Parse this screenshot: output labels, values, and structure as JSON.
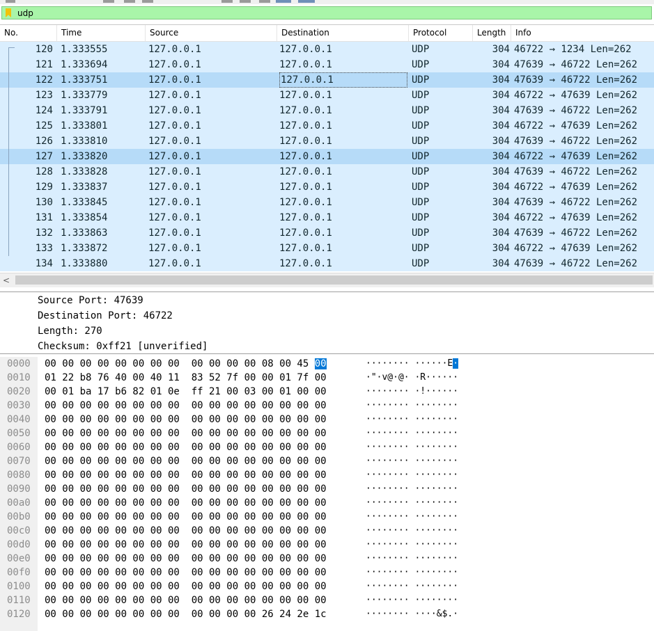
{
  "filter": {
    "value": "udp"
  },
  "columns": [
    "No.",
    "Time",
    "Source",
    "Destination",
    "Protocol",
    "Length",
    "Info"
  ],
  "packets": [
    {
      "no": "120",
      "time": "1.333555",
      "src": "127.0.0.1",
      "dst": "127.0.0.1",
      "proto": "UDP",
      "len": "304",
      "info": "46722 → 1234 Len=262",
      "state": "normal"
    },
    {
      "no": "121",
      "time": "1.333694",
      "src": "127.0.0.1",
      "dst": "127.0.0.1",
      "proto": "UDP",
      "len": "304",
      "info": "47639 → 46722 Len=262",
      "state": "normal"
    },
    {
      "no": "122",
      "time": "1.333751",
      "src": "127.0.0.1",
      "dst": "127.0.0.1",
      "proto": "UDP",
      "len": "304",
      "info": "47639 → 46722 Len=262",
      "state": "selected"
    },
    {
      "no": "123",
      "time": "1.333779",
      "src": "127.0.0.1",
      "dst": "127.0.0.1",
      "proto": "UDP",
      "len": "304",
      "info": "46722 → 47639 Len=262",
      "state": "normal"
    },
    {
      "no": "124",
      "time": "1.333791",
      "src": "127.0.0.1",
      "dst": "127.0.0.1",
      "proto": "UDP",
      "len": "304",
      "info": "47639 → 46722 Len=262",
      "state": "normal"
    },
    {
      "no": "125",
      "time": "1.333801",
      "src": "127.0.0.1",
      "dst": "127.0.0.1",
      "proto": "UDP",
      "len": "304",
      "info": "46722 → 47639 Len=262",
      "state": "normal"
    },
    {
      "no": "126",
      "time": "1.333810",
      "src": "127.0.0.1",
      "dst": "127.0.0.1",
      "proto": "UDP",
      "len": "304",
      "info": "47639 → 46722 Len=262",
      "state": "normal"
    },
    {
      "no": "127",
      "time": "1.333820",
      "src": "127.0.0.1",
      "dst": "127.0.0.1",
      "proto": "UDP",
      "len": "304",
      "info": "46722 → 47639 Len=262",
      "state": "related"
    },
    {
      "no": "128",
      "time": "1.333828",
      "src": "127.0.0.1",
      "dst": "127.0.0.1",
      "proto": "UDP",
      "len": "304",
      "info": "47639 → 46722 Len=262",
      "state": "normal"
    },
    {
      "no": "129",
      "time": "1.333837",
      "src": "127.0.0.1",
      "dst": "127.0.0.1",
      "proto": "UDP",
      "len": "304",
      "info": "46722 → 47639 Len=262",
      "state": "normal"
    },
    {
      "no": "130",
      "time": "1.333845",
      "src": "127.0.0.1",
      "dst": "127.0.0.1",
      "proto": "UDP",
      "len": "304",
      "info": "47639 → 46722 Len=262",
      "state": "normal"
    },
    {
      "no": "131",
      "time": "1.333854",
      "src": "127.0.0.1",
      "dst": "127.0.0.1",
      "proto": "UDP",
      "len": "304",
      "info": "46722 → 47639 Len=262",
      "state": "normal"
    },
    {
      "no": "132",
      "time": "1.333863",
      "src": "127.0.0.1",
      "dst": "127.0.0.1",
      "proto": "UDP",
      "len": "304",
      "info": "47639 → 46722 Len=262",
      "state": "normal"
    },
    {
      "no": "133",
      "time": "1.333872",
      "src": "127.0.0.1",
      "dst": "127.0.0.1",
      "proto": "UDP",
      "len": "304",
      "info": "46722 → 47639 Len=262",
      "state": "normal"
    },
    {
      "no": "134",
      "time": "1.333880",
      "src": "127.0.0.1",
      "dst": "127.0.0.1",
      "proto": "UDP",
      "len": "304",
      "info": "47639 → 46722 Len=262",
      "state": "normal"
    }
  ],
  "details": [
    "Source Port: 47639",
    "Destination Port: 46722",
    "Length: 270",
    "Checksum: 0xff21 [unverified]"
  ],
  "hex_rows": [
    {
      "offset": "0000",
      "bytes": "00 00 00 00 00 00 00 00  00 00 00 00 08 00 45 00",
      "ascii": "········ ······E·"
    },
    {
      "offset": "0010",
      "bytes": "01 22 b8 76 40 00 40 11  83 52 7f 00 00 01 7f 00",
      "ascii": "·\"·v@·@· ·R······"
    },
    {
      "offset": "0020",
      "bytes": "00 01 ba 17 b6 82 01 0e  ff 21 00 03 00 01 00 00",
      "ascii": "········ ·!······"
    },
    {
      "offset": "0030",
      "bytes": "00 00 00 00 00 00 00 00  00 00 00 00 00 00 00 00",
      "ascii": "········ ········"
    },
    {
      "offset": "0040",
      "bytes": "00 00 00 00 00 00 00 00  00 00 00 00 00 00 00 00",
      "ascii": "········ ········"
    },
    {
      "offset": "0050",
      "bytes": "00 00 00 00 00 00 00 00  00 00 00 00 00 00 00 00",
      "ascii": "········ ········"
    },
    {
      "offset": "0060",
      "bytes": "00 00 00 00 00 00 00 00  00 00 00 00 00 00 00 00",
      "ascii": "········ ········"
    },
    {
      "offset": "0070",
      "bytes": "00 00 00 00 00 00 00 00  00 00 00 00 00 00 00 00",
      "ascii": "········ ········"
    },
    {
      "offset": "0080",
      "bytes": "00 00 00 00 00 00 00 00  00 00 00 00 00 00 00 00",
      "ascii": "········ ········"
    },
    {
      "offset": "0090",
      "bytes": "00 00 00 00 00 00 00 00  00 00 00 00 00 00 00 00",
      "ascii": "········ ········"
    },
    {
      "offset": "00a0",
      "bytes": "00 00 00 00 00 00 00 00  00 00 00 00 00 00 00 00",
      "ascii": "········ ········"
    },
    {
      "offset": "00b0",
      "bytes": "00 00 00 00 00 00 00 00  00 00 00 00 00 00 00 00",
      "ascii": "········ ········"
    },
    {
      "offset": "00c0",
      "bytes": "00 00 00 00 00 00 00 00  00 00 00 00 00 00 00 00",
      "ascii": "········ ········"
    },
    {
      "offset": "00d0",
      "bytes": "00 00 00 00 00 00 00 00  00 00 00 00 00 00 00 00",
      "ascii": "········ ········"
    },
    {
      "offset": "00e0",
      "bytes": "00 00 00 00 00 00 00 00  00 00 00 00 00 00 00 00",
      "ascii": "········ ········"
    },
    {
      "offset": "00f0",
      "bytes": "00 00 00 00 00 00 00 00  00 00 00 00 00 00 00 00",
      "ascii": "········ ········"
    },
    {
      "offset": "0100",
      "bytes": "00 00 00 00 00 00 00 00  00 00 00 00 00 00 00 00",
      "ascii": "········ ········"
    },
    {
      "offset": "0110",
      "bytes": "00 00 00 00 00 00 00 00  00 00 00 00 00 00 00 00",
      "ascii": "········ ········"
    },
    {
      "offset": "0120",
      "bytes": "00 00 00 00 00 00 00 00  00 00 00 00 26 24 2e 1c",
      "ascii": "········ ····&$.·"
    }
  ],
  "scroll_arrow": "<",
  "colors": {
    "filter_bg": "#a9f5a9",
    "row_bg": "#daeefe",
    "row_selected_bg": "#b6dbf8",
    "highlight": "#0078d7"
  }
}
